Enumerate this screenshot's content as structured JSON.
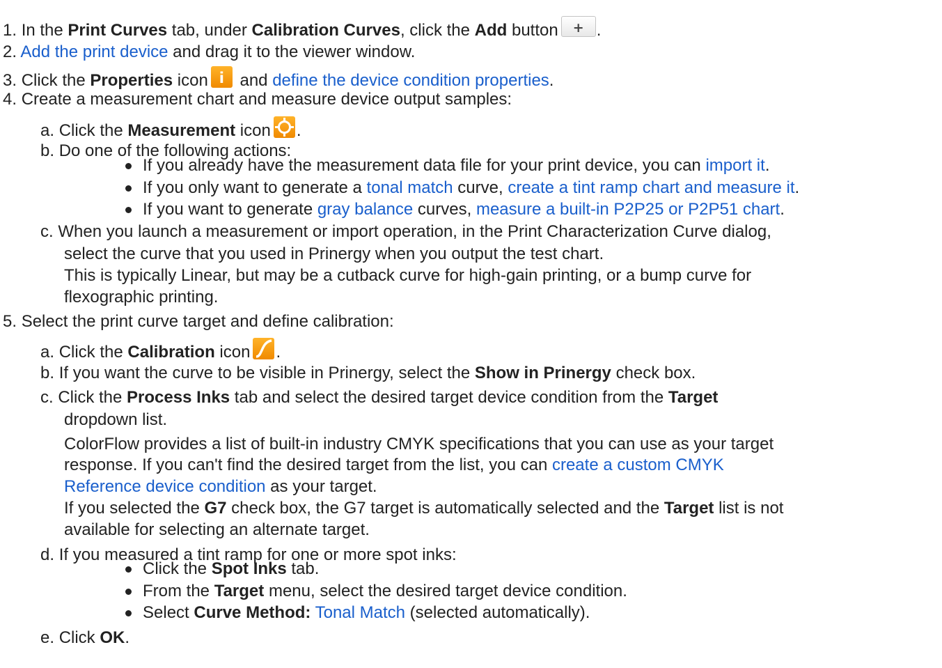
{
  "steps": {
    "s1": {
      "num": "1.",
      "t1": "In the ",
      "b1": "Print Curves",
      "t2": " tab, under ",
      "b2": "Calibration Curves",
      "t3": ", click the ",
      "b3": "Add",
      "t4": " button",
      "t5": ".",
      "icon": "plus-icon",
      "button_symbol": "+"
    },
    "s2": {
      "num": "2.",
      "link1": "Add the print device",
      "t1": " and drag it to the viewer window."
    },
    "s3": {
      "num": "3.",
      "t1": "Click the ",
      "b1": "Properties",
      "t2": " icon",
      "t3": " and ",
      "link1": "define the device condition properties",
      "t4": ".",
      "icon": "info-icon",
      "icon_symbol": "i"
    },
    "s4": {
      "num": "4.",
      "text": "Create a measurement chart and measure device output samples:",
      "a": {
        "label": "a.",
        "t1": "Click the ",
        "b1": "Measurement",
        "t2": " icon",
        "t3": ".",
        "icon": "crosshair-icon"
      },
      "b": {
        "label": "b.",
        "text": "Do one of the following actions:",
        "bullets": {
          "i1": {
            "t1": "If you already have the measurement data file for your print device, you can ",
            "link1": "import it",
            "t2": "."
          },
          "i2": {
            "t1": "If you only want to generate a ",
            "link1": "tonal match",
            "t2": " curve, ",
            "link2": "create a tint ramp chart and measure it",
            "t3": "."
          },
          "i3": {
            "t1": "If you want to generate ",
            "link1": "gray balance",
            "t2": " curves, ",
            "link2": "measure a built-in P2P25 or P2P51 chart",
            "t3": "."
          }
        }
      },
      "c": {
        "label": "c.",
        "line1": "When you launch a measurement or import operation, in the Print Characterization Curve dialog,",
        "line2": "select the curve that you used in Prinergy when you output the test chart.",
        "line3": "This is typically Linear, but may be a cutback curve for high-gain printing, or a bump curve for",
        "line4": "flexographic printing."
      }
    },
    "s5": {
      "num": "5.",
      "text": "Select the print curve target and define calibration:",
      "a": {
        "label": "a.",
        "t1": "Click the ",
        "b1": "Calibration",
        "t2": " icon",
        "t3": ".",
        "icon": "curve-icon"
      },
      "b": {
        "label": "b.",
        "t1": "If you want the curve to be visible in Prinergy, select the ",
        "b1": "Show in Prinergy",
        "t2": " check box."
      },
      "c": {
        "label": "c.",
        "t1": "Click the ",
        "b1": "Process Inks",
        "t2": " tab and select the desired target device condition from the ",
        "b2": "Target",
        "l2": "dropdown list.",
        "l3": "ColorFlow provides a list of built-in industry CMYK specifications that you can use as your target",
        "l4": "response. If you can't find the desired target from the list, you can ",
        "link1a": "create a custom CMYK",
        "link1b": "Reference device condition",
        "l5": " as your target.",
        "l6a": "If you selected the ",
        "l6b": "G7",
        "l6c": " check box, the G7 target is automatically selected and the ",
        "l6d": "Target",
        "l6e": " list is not",
        "l7": "available for selecting an alternate target."
      },
      "d": {
        "label": "d.",
        "text": "If you measured a tint ramp for one or more spot inks:",
        "bullets": {
          "i1": {
            "t1": "Click the ",
            "b1": "Spot Inks",
            "t2": " tab."
          },
          "i2": {
            "t1": "From the ",
            "b1": "Target",
            "t2": " menu, select the desired target device condition."
          },
          "i3": {
            "t1": "Select ",
            "b1": "Curve Method:",
            "link1": "Tonal Match",
            "t2": " (selected automatically)."
          }
        }
      },
      "e": {
        "label": "e.",
        "t1": "Click ",
        "b1": "OK",
        "t2": "."
      }
    }
  },
  "colors": {
    "text": "#222222",
    "link": "#1a5fcc",
    "icon_orange": "#f59a00",
    "button_border": "#c4c4c4"
  }
}
